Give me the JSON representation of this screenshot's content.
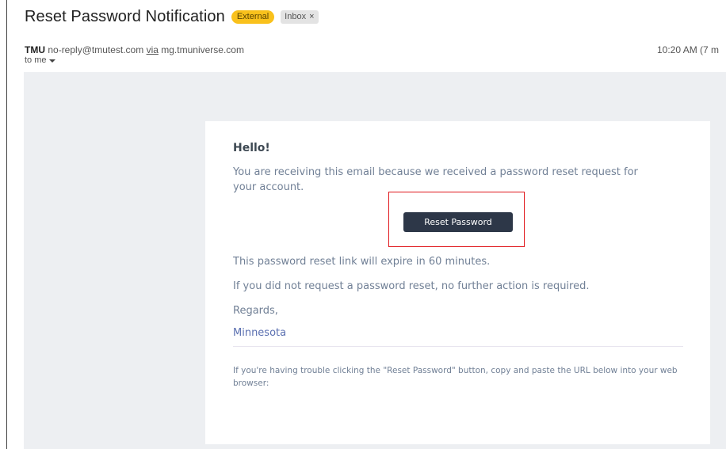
{
  "header": {
    "subject": "Reset Password Notification",
    "badges": {
      "external": "External",
      "inbox": "Inbox",
      "inbox_remove": "×"
    },
    "sender": {
      "name": "TMU",
      "email": "no-reply@tmutest.com",
      "via_label": "via",
      "via_domain": "mg.tmuniverse.com"
    },
    "to_label": "to me",
    "time": "10:20 AM (7 m"
  },
  "email": {
    "greeting": "Hello!",
    "intro": "You are receiving this email because we received a password reset request for your account.",
    "button_label": "Reset Password",
    "expire_text": "This password reset link will expire in 60 minutes.",
    "no_action_text": "If you did not request a password reset, no further action is required.",
    "regards": "Regards,",
    "signature": "Minnesota",
    "trouble_text": "If you're having trouble clicking the \"Reset Password\" button, copy and paste the URL below into your web browser:"
  },
  "colors": {
    "badge_external": "#f9c11c",
    "button_bg": "#2d3748",
    "highlight_border": "#e0161b",
    "email_bg": "#edeff2"
  }
}
